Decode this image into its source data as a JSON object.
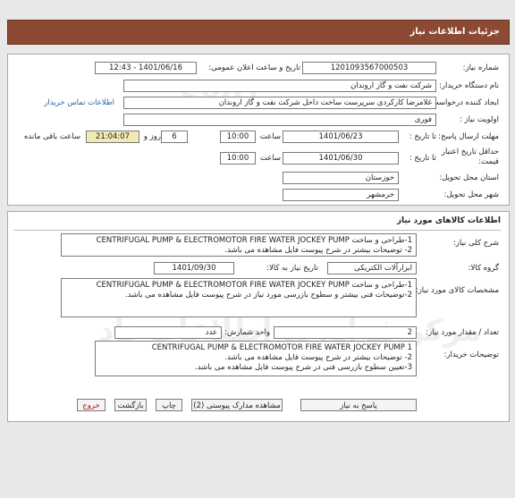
{
  "header": {
    "title": "جزئیات اطلاعات نیاز"
  },
  "info": {
    "need_number_label": "شماره نیاز:",
    "need_number": "1201093567000503",
    "announce_label": "تاریخ و ساعت اعلان عمومی:",
    "announce_value": "1401/06/16 - 12:43",
    "buyer_org_label": "نام دستگاه خریدار:",
    "buyer_org": "شرکت نفت و گاز اروندان",
    "requester_label": "ایجاد کننده درخواست:",
    "requester": "غلامرضا کارکردی سرپرست ساخت داخل شرکت نفت و گاز اروندان",
    "contact_link": "اطلاعات تماس خریدار",
    "priority_label": "اولویت نیاز :",
    "priority": "فوری",
    "reply_deadline_label": "مهلت ارسال پاسخ:",
    "to_date_label": "تا تاریخ :",
    "reply_date": "1401/06/23",
    "time_label": "ساعت",
    "reply_time": "10:00",
    "days": "6",
    "days_label": "روز و",
    "remaining": "21:04:07",
    "remaining_label": "ساعت باقی مانده",
    "price_validity_label": "حداقل تاریخ اعتبار",
    "price_validity_label2": "قیمت:",
    "validity_date": "1401/06/30",
    "validity_time": "10:00",
    "province_label": "استان محل تحویل:",
    "province": "خوزستان",
    "city_label": "شهر محل تحویل:",
    "city": "خرمشهر"
  },
  "goods": {
    "section_title": "اطلاعات کالاهای مورد نیاز",
    "summary_label": "شرح کلی نیاز:",
    "summary_lines": [
      "1-طراحی و ساخت CENTRIFUGAL PUMP & ELECTROMOTOR FIRE WATER JOCKEY PUMP",
      "2- توضیحات بیشتر در شرح پیوست فایل مشاهده می باشد."
    ],
    "group_label": "گروه کالا:",
    "group": "ابزارآلات الکتریکی",
    "need_date_label": "تاریخ نیاز به کالا:",
    "need_date": "1401/09/30",
    "specs_label": "مشخصات کالای مورد نیاز:",
    "specs_lines": [
      "1-طراحی و ساخت CENTRIFUGAL PUMP & ELECTROMOTOR FIRE WATER JOCKEY PUMP",
      "2-توضیحات فنی بیشتر و سطوح بازرسی مورد نیاز  در شرح پیوست فایل مشاهده می باشد."
    ],
    "qty_label": "تعداد / مقدار مورد نیاز:",
    "qty": "2",
    "unit_label": "واحد شمارش:",
    "unit": "عدد",
    "buyer_notes_label": "توضیحات خریدار:",
    "buyer_notes_lines": [
      "CENTRIFUGAL PUMP & ELECTROMOTOR FIRE WATER JOCKEY PUMP 1",
      "2- توضیحات بیشتر در شرح پیوست فایل مشاهده می باشد.",
      "3-تعیین سطوح بازرسی فنی در شرح پیوست فایل مشاهده می باشد."
    ]
  },
  "buttons": {
    "reply": "پاسخ به نیاز",
    "attachments": "مشاهده مدارک پیوستی (2)",
    "print": "چاپ",
    "back": "بازگشت",
    "exit": "خروج"
  },
  "colors": {
    "header_bg": "#8c4a34",
    "remaining_bg": "#f2eab5",
    "link": "#1f5fa8",
    "exit": "#cc0000"
  }
}
